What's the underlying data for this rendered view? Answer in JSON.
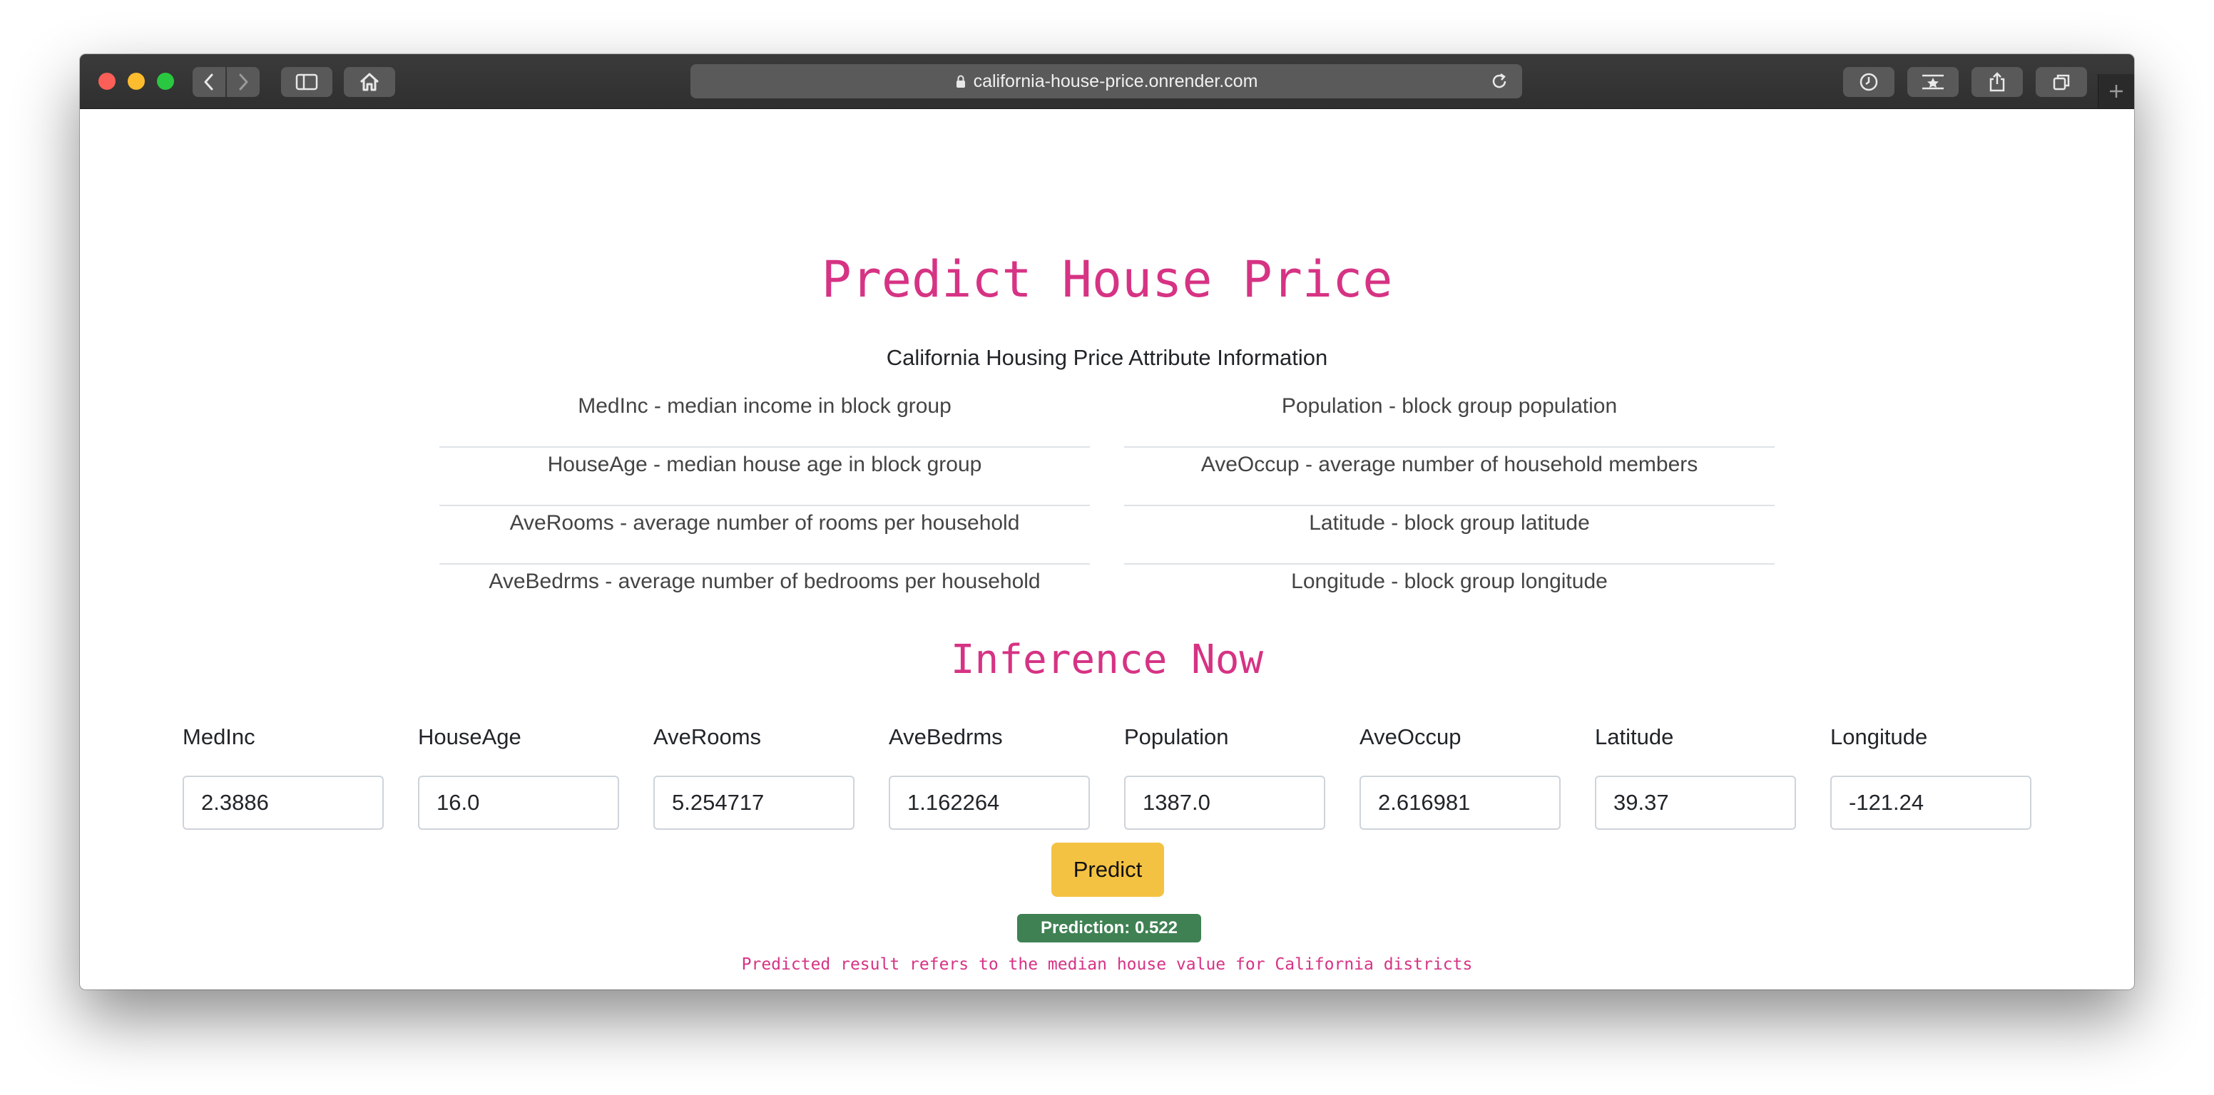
{
  "browser": {
    "url": "california-house-price.onrender.com",
    "icons": [
      "back-icon",
      "forward-icon",
      "sidebar-icon",
      "home-icon",
      "lock-icon",
      "reload-icon",
      "history-icon",
      "bookmark-star-icon",
      "share-icon",
      "tabs-icon",
      "new-tab-icon"
    ]
  },
  "page": {
    "title": "Predict House Price",
    "subtitle": "California Housing Price Attribute Information",
    "attributes_left": [
      "MedInc - median income in block group",
      "HouseAge - median house age in block group",
      "AveRooms - average number of rooms per household",
      "AveBedrms - average number of bedrooms per household"
    ],
    "attributes_right": [
      "Population - block group population",
      "AveOccup - average number of household members",
      "Latitude - block group latitude",
      "Longitude - block group longitude"
    ],
    "inference_heading": "Inference Now",
    "fields": [
      {
        "label": "MedInc",
        "value": "2.3886"
      },
      {
        "label": "HouseAge",
        "value": "16.0"
      },
      {
        "label": "AveRooms",
        "value": "5.254717"
      },
      {
        "label": "AveBedrms",
        "value": "1.162264"
      },
      {
        "label": "Population",
        "value": "1387.0"
      },
      {
        "label": "AveOccup",
        "value": "2.616981"
      },
      {
        "label": "Latitude",
        "value": "39.37"
      },
      {
        "label": "Longitude",
        "value": "-121.24"
      }
    ],
    "predict_label": "Predict",
    "prediction_badge": "Prediction: 0.522",
    "note": "Predicted result refers to the median house value for California districts"
  },
  "colors": {
    "accent": "#d63384",
    "predict_button": "#f4c242",
    "badge": "#3f8153",
    "close": "#fc5f57",
    "minimize": "#fdbc2e",
    "zoom": "#29c840"
  }
}
